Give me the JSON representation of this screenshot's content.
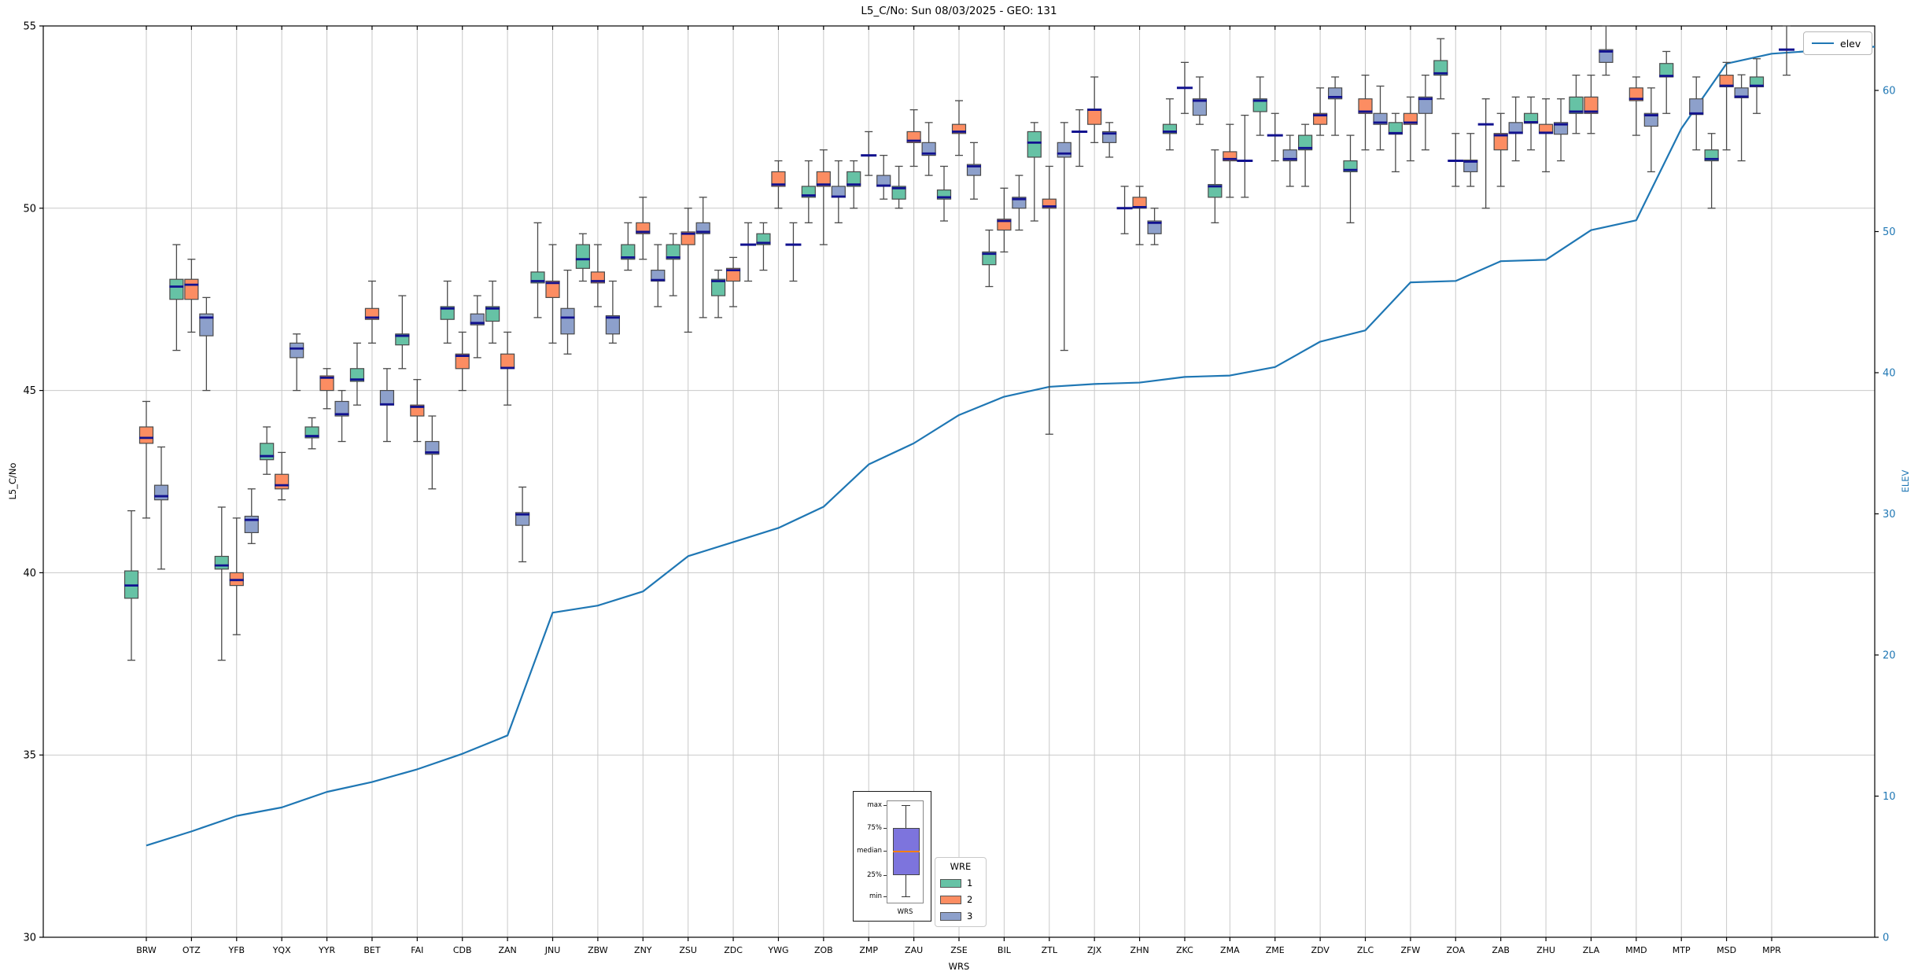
{
  "title": "L5_C/No: Sun 08/03/2025 - GEO: 131",
  "axes": {
    "left": {
      "label": "L5_C/No",
      "min": 30,
      "max": 55,
      "ticks": [
        30,
        35,
        40,
        45,
        50,
        55
      ]
    },
    "right": {
      "label": "ELEV",
      "ticks": [
        0,
        10,
        20,
        30,
        40,
        50,
        60
      ]
    },
    "x": {
      "label": "WRS"
    }
  },
  "legend_elev": {
    "label": "elev"
  },
  "legend_wre": {
    "title": "WRE",
    "items": [
      {
        "label": "1",
        "color": "#66c2a5"
      },
      {
        "label": "2",
        "color": "#fc8d62"
      },
      {
        "label": "3",
        "color": "#8da0cb"
      }
    ]
  },
  "inset": {
    "labels": {
      "max": "max",
      "p75": "75%",
      "median": "median",
      "p25": "25%",
      "min": "min"
    },
    "xlabel": "WRS",
    "box_color": "#7d74dd",
    "median_color": "#ff7f0e"
  },
  "colors": {
    "grid": "#c9c9c9",
    "spine": "#000000",
    "whisker": "#4a4a4a",
    "box_edge": "#4a4a4a",
    "median": "#12128f",
    "elev_line": "#1f77b4",
    "right_tick_label": "#1f77b4"
  },
  "chart_data": {
    "type": "box+line",
    "title": "L5_C/No: Sun 08/03/2025 - GEO: 131",
    "xlabel": "WRS",
    "ylabel_left": "L5_C/No",
    "ylabel_right": "ELEV",
    "ylim_left": [
      30,
      55
    ],
    "ylim_right": [
      0,
      64.5
    ],
    "grid": true,
    "categories": [
      "BRW",
      "OTZ",
      "YFB",
      "YQX",
      "YYR",
      "BET",
      "FAI",
      "CDB",
      "ZAN",
      "JNU",
      "ZBW",
      "ZNY",
      "ZSU",
      "ZDC",
      "YWG",
      "ZOB",
      "ZMP",
      "ZAU",
      "ZSE",
      "BIL",
      "ZTL",
      "ZJX",
      "ZHN",
      "ZKC",
      "ZMA",
      "ZME",
      "ZDV",
      "ZLC",
      "ZFW",
      "ZOA",
      "ZAB",
      "ZHU",
      "ZLA",
      "MMD",
      "MTP",
      "MSD",
      "MPR"
    ],
    "series": [
      {
        "name": "1",
        "color": "#66c2a5",
        "boxes": [
          [
            37.6,
            39.3,
            39.65,
            40.05,
            41.7
          ],
          [
            46.1,
            47.5,
            47.85,
            48.05,
            49.0
          ],
          [
            37.6,
            40.1,
            40.2,
            40.45,
            41.8
          ],
          [
            42.7,
            43.1,
            43.2,
            43.55,
            44.0
          ],
          [
            43.4,
            43.7,
            43.75,
            44.0,
            44.25
          ],
          [
            44.6,
            45.25,
            45.3,
            45.6,
            46.3
          ],
          [
            45.6,
            46.25,
            46.5,
            46.55,
            47.6
          ],
          [
            46.3,
            46.95,
            47.25,
            47.3,
            48.0
          ],
          [
            46.3,
            46.9,
            47.25,
            47.3,
            48.0
          ],
          [
            47.0,
            47.95,
            48.0,
            48.25,
            49.6
          ],
          [
            48.0,
            48.35,
            48.6,
            49.0,
            49.3
          ],
          [
            48.3,
            48.6,
            48.65,
            49.0,
            49.6
          ],
          [
            47.6,
            48.6,
            48.65,
            49.0,
            49.3
          ],
          [
            47.0,
            47.6,
            48.0,
            48.05,
            48.3
          ],
          [
            48.3,
            49.0,
            49.05,
            49.3,
            49.6
          ],
          [
            49.6,
            50.3,
            50.35,
            50.6,
            51.3
          ],
          [
            50.0,
            50.6,
            50.65,
            51.0,
            51.3
          ],
          [
            50.0,
            50.25,
            50.55,
            50.6,
            51.15
          ],
          [
            49.65,
            50.25,
            50.3,
            50.5,
            51.15
          ],
          [
            47.85,
            48.45,
            48.75,
            48.8,
            49.4
          ],
          [
            49.65,
            51.4,
            51.8,
            52.1,
            52.35
          ],
          [
            51.15,
            null,
            52.1,
            null,
            52.7
          ],
          [
            49.3,
            null,
            50.0,
            null,
            50.6
          ],
          [
            51.6,
            52.05,
            52.1,
            52.3,
            53.0
          ],
          [
            49.6,
            50.3,
            50.6,
            50.65,
            51.6
          ],
          [
            52.0,
            52.65,
            52.95,
            53.0,
            53.6
          ],
          [
            50.6,
            51.6,
            51.65,
            52.0,
            52.3
          ],
          [
            49.6,
            51.0,
            51.05,
            51.3,
            52.0
          ],
          [
            51.0,
            52.03,
            52.06,
            52.35,
            52.6
          ],
          [
            53.0,
            53.65,
            53.7,
            54.05,
            54.65
          ],
          [
            50.0,
            null,
            52.3,
            null,
            53.0
          ],
          [
            51.6,
            52.33,
            52.36,
            52.6,
            53.05
          ],
          [
            52.05,
            52.6,
            52.65,
            53.05,
            53.65
          ],
          null,
          [
            52.6,
            53.6,
            53.63,
            53.97,
            54.3
          ],
          [
            50.0,
            51.3,
            51.35,
            51.6,
            52.05
          ],
          [
            52.6,
            53.33,
            53.36,
            53.6,
            54.1
          ]
        ]
      },
      {
        "name": "2",
        "color": "#fc8d62",
        "boxes": [
          [
            41.5,
            43.55,
            43.7,
            44.0,
            44.7
          ],
          [
            46.6,
            47.5,
            47.9,
            48.05,
            48.6
          ],
          [
            38.3,
            39.65,
            39.8,
            40.0,
            41.5
          ],
          [
            42.0,
            42.3,
            42.4,
            42.7,
            43.3
          ],
          [
            44.5,
            45.0,
            45.35,
            45.4,
            45.6
          ],
          [
            46.3,
            46.95,
            47.0,
            47.25,
            48.0
          ],
          [
            43.6,
            44.3,
            44.55,
            44.6,
            45.3
          ],
          [
            45.0,
            45.6,
            45.95,
            46.0,
            46.6
          ],
          [
            44.6,
            45.6,
            45.62,
            46.0,
            46.6
          ],
          [
            46.3,
            47.55,
            47.95,
            48.0,
            49.0
          ],
          [
            47.3,
            47.95,
            48.0,
            48.25,
            49.0
          ],
          [
            48.6,
            49.3,
            49.35,
            49.6,
            50.3
          ],
          [
            46.6,
            49.0,
            49.3,
            49.35,
            50.0
          ],
          [
            47.3,
            48.0,
            48.3,
            48.35,
            48.65
          ],
          [
            50.0,
            50.6,
            50.65,
            51.0,
            51.3
          ],
          [
            49.0,
            50.6,
            50.65,
            51.0,
            51.6
          ],
          [
            50.9,
            null,
            51.45,
            null,
            52.1
          ],
          [
            51.15,
            51.8,
            51.85,
            52.1,
            52.7
          ],
          [
            51.45,
            52.05,
            52.1,
            52.3,
            52.95
          ],
          [
            48.8,
            49.4,
            49.65,
            49.7,
            50.55
          ],
          [
            43.8,
            50.0,
            50.05,
            50.25,
            51.15
          ],
          [
            51.8,
            52.3,
            52.7,
            52.72,
            53.6
          ],
          [
            49.0,
            50.0,
            50.03,
            50.3,
            50.6
          ],
          [
            52.6,
            null,
            53.3,
            null,
            54.0
          ],
          [
            50.3,
            51.3,
            51.35,
            51.55,
            52.3
          ],
          [
            51.3,
            null,
            52.0,
            null,
            52.6
          ],
          [
            52.0,
            52.3,
            52.55,
            52.6,
            53.3
          ],
          [
            51.6,
            52.6,
            52.65,
            53.0,
            53.65
          ],
          [
            51.3,
            52.3,
            52.35,
            52.6,
            53.05
          ],
          [
            50.6,
            null,
            51.3,
            null,
            52.05
          ],
          [
            50.6,
            51.6,
            52.0,
            52.05,
            52.6
          ],
          [
            51.0,
            52.05,
            52.07,
            52.3,
            53.0
          ],
          [
            52.05,
            52.6,
            52.65,
            53.05,
            53.65
          ],
          [
            52.0,
            52.95,
            53.0,
            53.3,
            53.6
          ],
          null,
          [
            51.6,
            53.33,
            53.36,
            53.65,
            54.0
          ],
          null
        ]
      },
      {
        "name": "3",
        "color": "#8da0cb",
        "boxes": [
          [
            40.1,
            42.0,
            42.1,
            42.4,
            43.45
          ],
          [
            45.0,
            46.5,
            47.0,
            47.1,
            47.55
          ],
          [
            40.8,
            41.1,
            41.45,
            41.55,
            42.3
          ],
          [
            45.0,
            45.9,
            46.15,
            46.3,
            46.55
          ],
          [
            43.6,
            44.3,
            44.35,
            44.7,
            45.0
          ],
          [
            43.6,
            44.6,
            44.62,
            45.0,
            45.6
          ],
          [
            42.3,
            43.25,
            43.3,
            43.6,
            44.3
          ],
          [
            45.9,
            46.8,
            46.85,
            47.1,
            47.6
          ],
          [
            40.3,
            41.3,
            41.6,
            41.65,
            42.35
          ],
          [
            46.0,
            46.55,
            47.0,
            47.25,
            48.3
          ],
          [
            46.3,
            46.55,
            47.0,
            47.05,
            48.0
          ],
          [
            47.3,
            48.0,
            48.03,
            48.3,
            49.0
          ],
          [
            47.0,
            49.3,
            49.35,
            49.6,
            50.3
          ],
          [
            48.0,
            null,
            49.0,
            null,
            49.6
          ],
          [
            48.0,
            null,
            49.0,
            null,
            49.6
          ],
          [
            49.6,
            50.3,
            50.32,
            50.6,
            51.3
          ],
          [
            50.25,
            50.6,
            50.62,
            50.9,
            51.45
          ],
          [
            50.9,
            51.45,
            51.5,
            51.8,
            52.35
          ],
          [
            50.25,
            50.9,
            51.15,
            51.2,
            51.8
          ],
          [
            49.4,
            50.0,
            50.25,
            50.3,
            50.9
          ],
          [
            46.1,
            51.4,
            51.5,
            51.8,
            52.35
          ],
          [
            51.4,
            51.8,
            52.05,
            52.1,
            52.35
          ],
          [
            49.0,
            49.3,
            49.6,
            49.65,
            50.0
          ],
          [
            52.3,
            52.55,
            52.95,
            53.0,
            53.6
          ],
          [
            50.3,
            null,
            51.3,
            null,
            52.55
          ],
          [
            50.6,
            51.3,
            51.35,
            51.6,
            52.0
          ],
          [
            52.0,
            53.0,
            53.05,
            53.3,
            53.6
          ],
          [
            51.6,
            52.3,
            52.35,
            52.6,
            53.35
          ],
          [
            51.6,
            52.6,
            53.0,
            53.05,
            53.65
          ],
          [
            50.6,
            51.0,
            51.28,
            51.32,
            52.05
          ],
          [
            51.3,
            52.05,
            52.07,
            52.35,
            53.05
          ],
          [
            51.3,
            52.03,
            52.3,
            52.35,
            53.0
          ],
          [
            53.65,
            54.0,
            54.3,
            54.35,
            55.0
          ],
          [
            51.0,
            52.25,
            52.55,
            52.6,
            53.3
          ],
          [
            51.6,
            52.57,
            52.6,
            53.0,
            53.6
          ],
          [
            51.3,
            53.03,
            53.06,
            53.3,
            53.66
          ],
          [
            53.65,
            null,
            54.35,
            null,
            55.0
          ]
        ]
      }
    ],
    "line": {
      "name": "elev",
      "color": "#1f77b4",
      "axis": "right",
      "values": [
        6.5,
        7.5,
        8.6,
        9.2,
        10.3,
        11.0,
        11.9,
        13.0,
        14.3,
        23.0,
        23.5,
        24.5,
        27.0,
        28.0,
        29.0,
        30.5,
        33.5,
        35.0,
        37.0,
        38.3,
        39.0,
        39.2,
        39.3,
        39.7,
        39.8,
        40.4,
        42.2,
        43.0,
        46.4,
        46.5,
        47.9,
        48.0,
        50.1,
        50.8,
        57.3,
        61.9,
        62.6
      ],
      "end_extension_value": 63.1
    }
  }
}
